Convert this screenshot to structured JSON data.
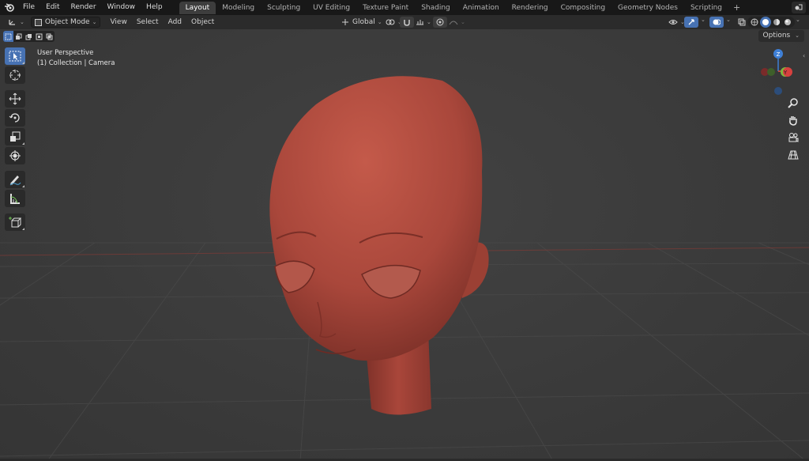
{
  "menu": {
    "file": "File",
    "edit": "Edit",
    "render": "Render",
    "window": "Window",
    "help": "Help"
  },
  "workspaces": [
    {
      "label": "Layout",
      "active": true
    },
    {
      "label": "Modeling"
    },
    {
      "label": "Sculpting"
    },
    {
      "label": "UV Editing"
    },
    {
      "label": "Texture Paint"
    },
    {
      "label": "Shading"
    },
    {
      "label": "Animation"
    },
    {
      "label": "Rendering"
    },
    {
      "label": "Compositing"
    },
    {
      "label": "Geometry Nodes"
    },
    {
      "label": "Scripting"
    }
  ],
  "header": {
    "mode": "Object Mode",
    "view": "View",
    "select": "Select",
    "add": "Add",
    "object": "Object",
    "orientation": "Global",
    "options": "Options"
  },
  "overlay": {
    "perspective": "User Perspective",
    "collection": "(1) Collection | Camera"
  },
  "gizmo": {
    "z": "Z",
    "y": "Y"
  },
  "colors": {
    "accent": "#4772b3",
    "model": "#b34a3c",
    "axis_x": "#d8413f",
    "axis_y": "#7fb63c",
    "axis_z": "#3e7fd6"
  },
  "icons": {
    "app": "blender-logo-icon",
    "scene": "scene-icon"
  }
}
